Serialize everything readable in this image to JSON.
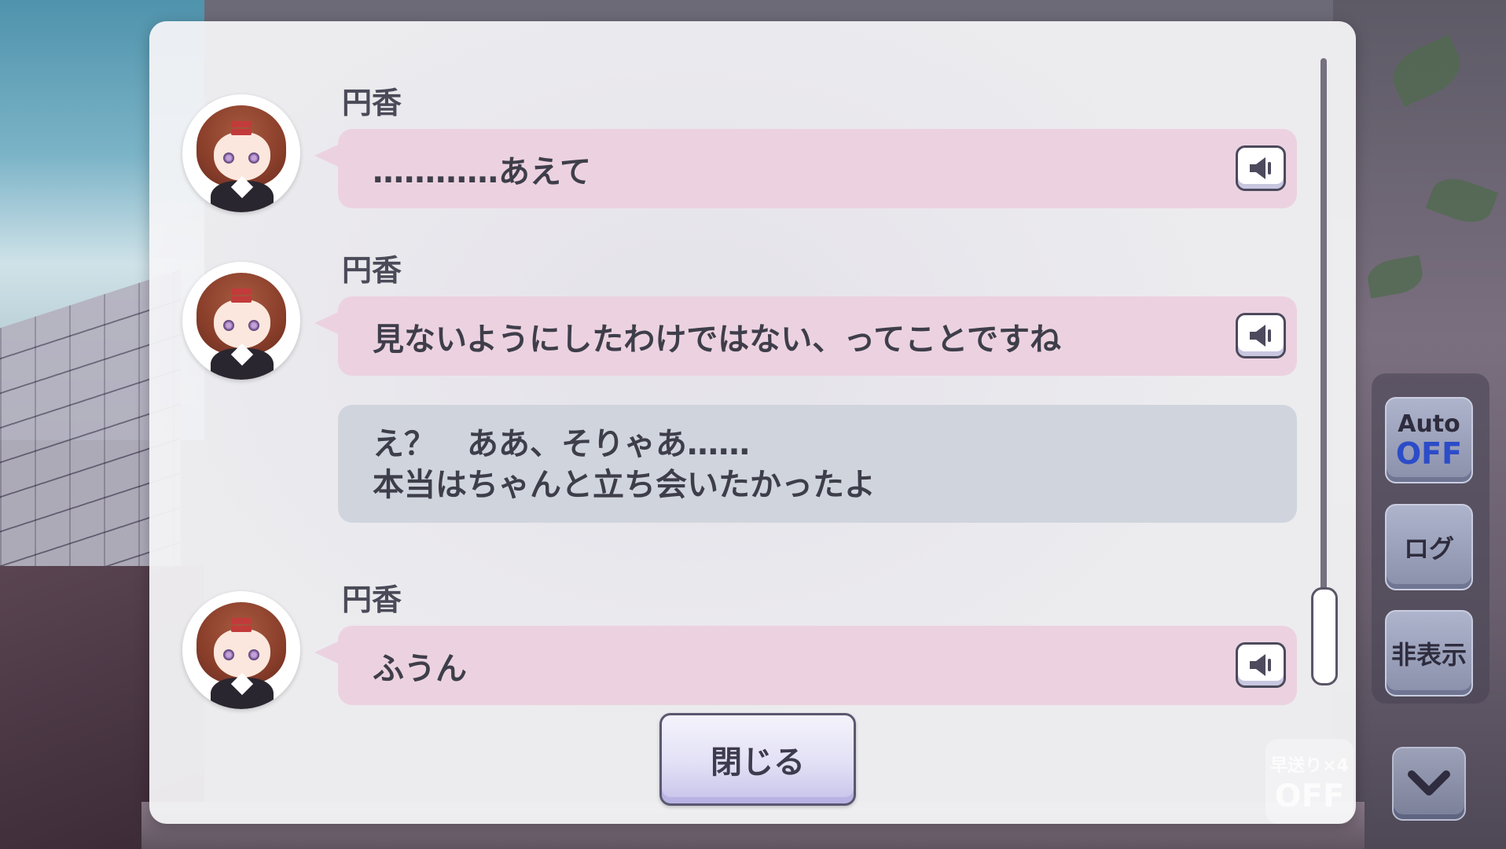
{
  "log": {
    "entries": [
      {
        "speaker": "円香",
        "text": "…………あえて",
        "style": "pink",
        "has_voice": true
      },
      {
        "speaker": "円香",
        "text": "見ないようにしたわけではない、ってことですね",
        "style": "pink",
        "has_voice": true
      },
      {
        "speaker": "",
        "lines": [
          "え？　ああ、そりゃあ……",
          "本当はちゃんと立ち会いたかったよ"
        ],
        "style": "gray",
        "has_voice": false
      },
      {
        "speaker": "円香",
        "text": "ふうん",
        "style": "pink",
        "has_voice": true
      }
    ],
    "close_label": "閉じる"
  },
  "controls": {
    "auto_label": "Auto",
    "auto_state": "OFF",
    "log_label": "ログ",
    "hide_label": "非表示",
    "fast_forward_label": "早送り×4",
    "fast_forward_state": "OFF"
  },
  "icons": {
    "voice": "speaker-icon",
    "scroll_down": "chevron-down-icon"
  },
  "colors": {
    "speaker_bubble": "#ecd2e0",
    "narration_bubble": "#d0d5dd",
    "auto_off": "#2c4cc8"
  }
}
